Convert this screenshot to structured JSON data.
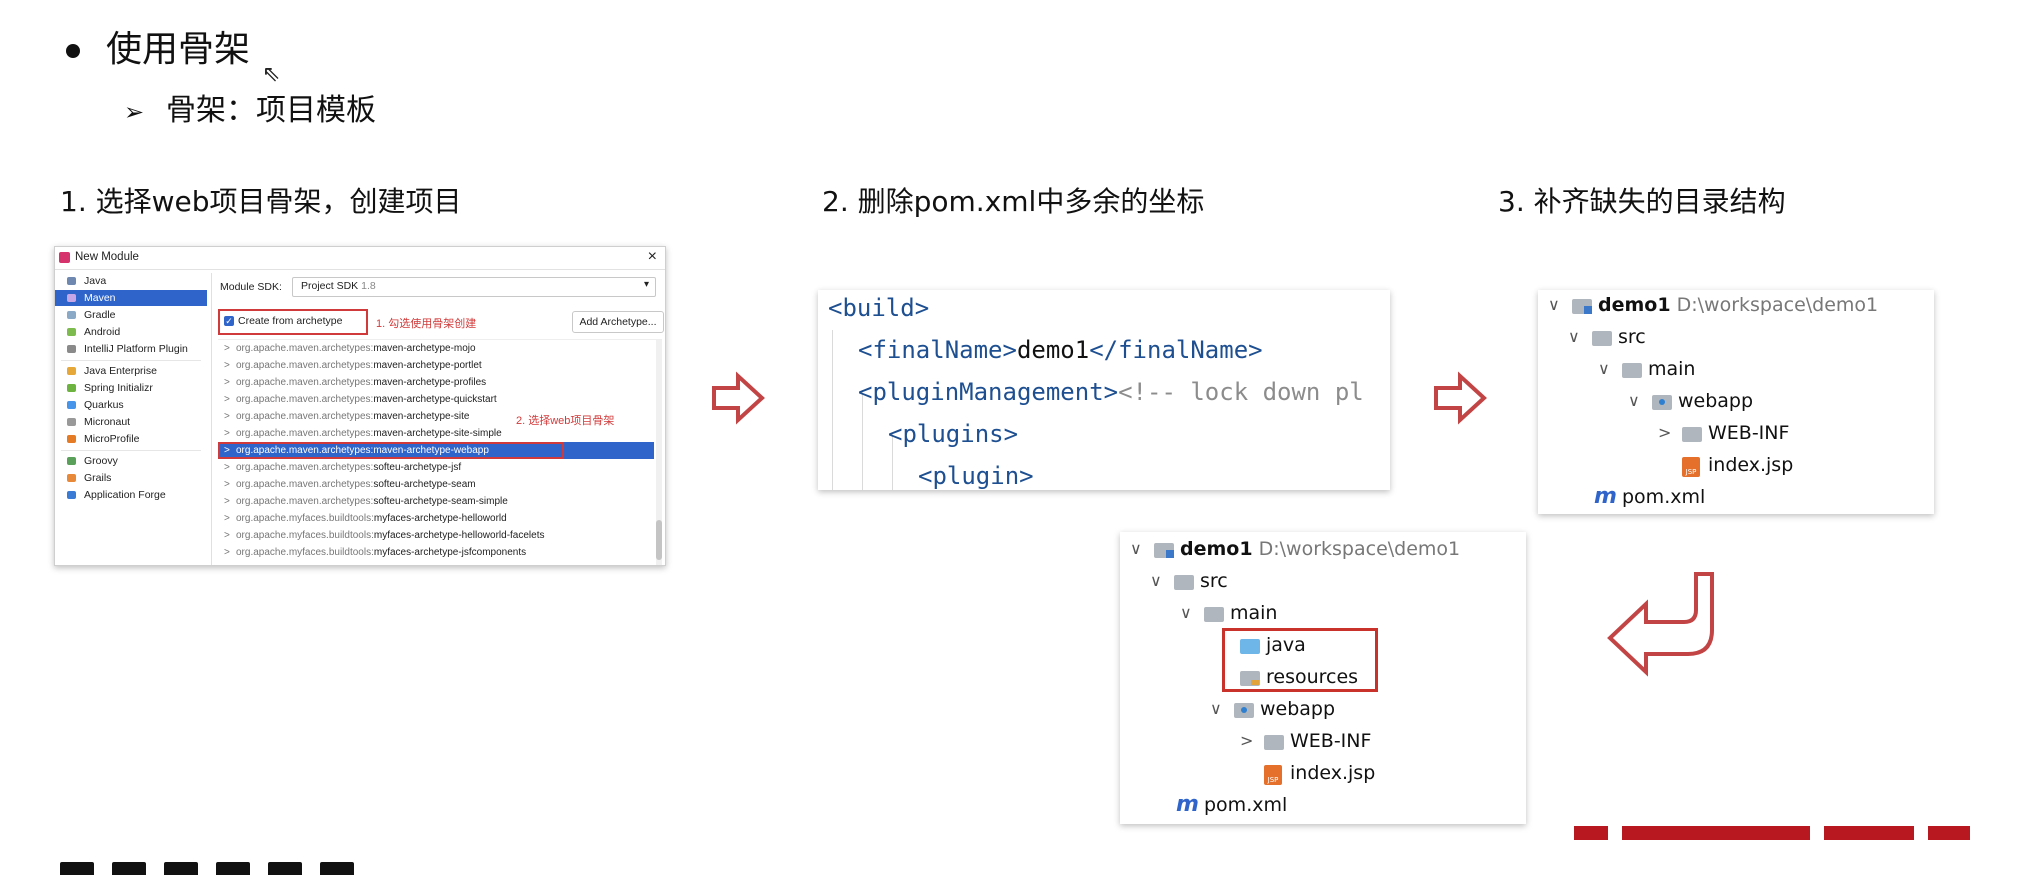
{
  "slide": {
    "heading": "使用骨架",
    "subpoint": "骨架：项目模板",
    "steps": [
      "1. 选择web项目骨架，创建项目",
      "2. 删除pom.xml中多余的坐标",
      "3. 补齐缺失的目录结构"
    ]
  },
  "dialog": {
    "title": "New Module",
    "close": "×",
    "sidebar": [
      {
        "label": "Java",
        "color": "#6e88b0"
      },
      {
        "label": "Maven",
        "color": "#c7a6e8",
        "selected": true
      },
      {
        "label": "Gradle",
        "color": "#8aa9c6"
      },
      {
        "label": "Android",
        "color": "#7dbb4f"
      },
      {
        "label": "IntelliJ Platform Plugin",
        "color": "#8a8a8a"
      },
      {
        "label": "Java Enterprise",
        "color": "#e7a83a"
      },
      {
        "label": "Spring Initializr",
        "color": "#6db33f"
      },
      {
        "label": "Quarkus",
        "color": "#4695eb"
      },
      {
        "label": "Micronaut",
        "color": "#999999"
      },
      {
        "label": "MicroProfile",
        "color": "#e57b25"
      },
      {
        "label": "Groovy",
        "color": "#5aa05a"
      },
      {
        "label": "Grails",
        "color": "#e8893a"
      },
      {
        "label": "Application Forge",
        "color": "#3a7bd5"
      }
    ],
    "sdk_label": "Module SDK:",
    "sdk_value": "Project SDK",
    "sdk_version": "1.8",
    "create_from_archetype": "Create from archetype",
    "note1": "1. 勾选使用骨架创建",
    "add_archetype": "Add Archetype...",
    "note2": "2. 选择web项目骨架",
    "archetypes": [
      {
        "group": "org.apache.maven.archetypes:",
        "artifact": "maven-archetype-mojo"
      },
      {
        "group": "org.apache.maven.archetypes:",
        "artifact": "maven-archetype-portlet"
      },
      {
        "group": "org.apache.maven.archetypes:",
        "artifact": "maven-archetype-profiles"
      },
      {
        "group": "org.apache.maven.archetypes:",
        "artifact": "maven-archetype-quickstart"
      },
      {
        "group": "org.apache.maven.archetypes:",
        "artifact": "maven-archetype-site"
      },
      {
        "group": "org.apache.maven.archetypes:",
        "artifact": "maven-archetype-site-simple"
      },
      {
        "group": "org.apache.maven.archetypes:",
        "artifact": "maven-archetype-webapp",
        "selected": true
      },
      {
        "group": "org.apache.maven.archetypes:",
        "artifact": "softeu-archetype-jsf"
      },
      {
        "group": "org.apache.maven.archetypes:",
        "artifact": "softeu-archetype-seam"
      },
      {
        "group": "org.apache.maven.archetypes:",
        "artifact": "softeu-archetype-seam-simple"
      },
      {
        "group": "org.apache.myfaces.buildtools:",
        "artifact": "myfaces-archetype-helloworld"
      },
      {
        "group": "org.apache.myfaces.buildtools:",
        "artifact": "myfaces-archetype-helloworld-facelets"
      },
      {
        "group": "org.apache.myfaces.buildtools:",
        "artifact": "myfaces-archetype-jsfcomponents"
      }
    ],
    "chevron": ">"
  },
  "code": {
    "l1_tag": "<build>",
    "l2_open": "<finalName>",
    "l2_text": "demo1",
    "l2_close": "</finalName>",
    "l3_tag": "<pluginManagement>",
    "l3_comment": "<!-- lock down pl",
    "l4_tag": "<plugins>",
    "l5_tag": "<plugin>"
  },
  "tree_small": {
    "root": "demo1",
    "root_path": "D:\\workspace\\demo1",
    "src": "src",
    "main": "main",
    "webapp": "webapp",
    "webinf": "WEB-INF",
    "indexjsp": "index.jsp",
    "pom": "pom.xml"
  },
  "tree_full": {
    "root": "demo1",
    "root_path": "D:\\workspace\\demo1",
    "src": "src",
    "main": "main",
    "java": "java",
    "resources": "resources",
    "webapp": "webapp",
    "webinf": "WEB-INF",
    "indexjsp": "index.jsp",
    "pom": "pom.xml"
  },
  "icons": {
    "expanded": "∨",
    "collapsed": ">",
    "maven_mark": "m",
    "jsp_mark": "JSP"
  },
  "colors": {
    "accent_red": "#c9312b",
    "selection_blue": "#2f65ca",
    "code_tag": "#1d4f91"
  }
}
